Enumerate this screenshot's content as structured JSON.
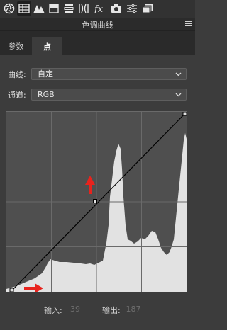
{
  "toolbar": {
    "tools": [
      {
        "name": "aperture-icon",
        "active": false
      },
      {
        "name": "basic-grid-icon",
        "active": true
      },
      {
        "name": "mountains-icon",
        "active": false
      },
      {
        "name": "split-icon",
        "active": false
      },
      {
        "name": "hsl-bars-icon",
        "active": false
      },
      {
        "name": "lens-icon",
        "active": false
      },
      {
        "name": "fx-icon",
        "active": false
      },
      {
        "name": "camera-icon",
        "active": false
      },
      {
        "name": "presets-icon",
        "active": false
      },
      {
        "name": "snapshots-icon",
        "active": false
      }
    ]
  },
  "panel": {
    "title": "色调曲线"
  },
  "tabs": {
    "tab1": "参数",
    "tab2": "点"
  },
  "curve": {
    "label": "曲线:",
    "value": "自定"
  },
  "channel": {
    "label": "通道:",
    "value": "RGB"
  },
  "io": {
    "input_label": "输入:",
    "input_value": "39",
    "output_label": "输出:",
    "output_value": "187"
  },
  "colors": {
    "histogram": "#e2e2e2",
    "grid": "#6a6a6a",
    "arrow": "#e8231d",
    "curve": "#000000"
  }
}
